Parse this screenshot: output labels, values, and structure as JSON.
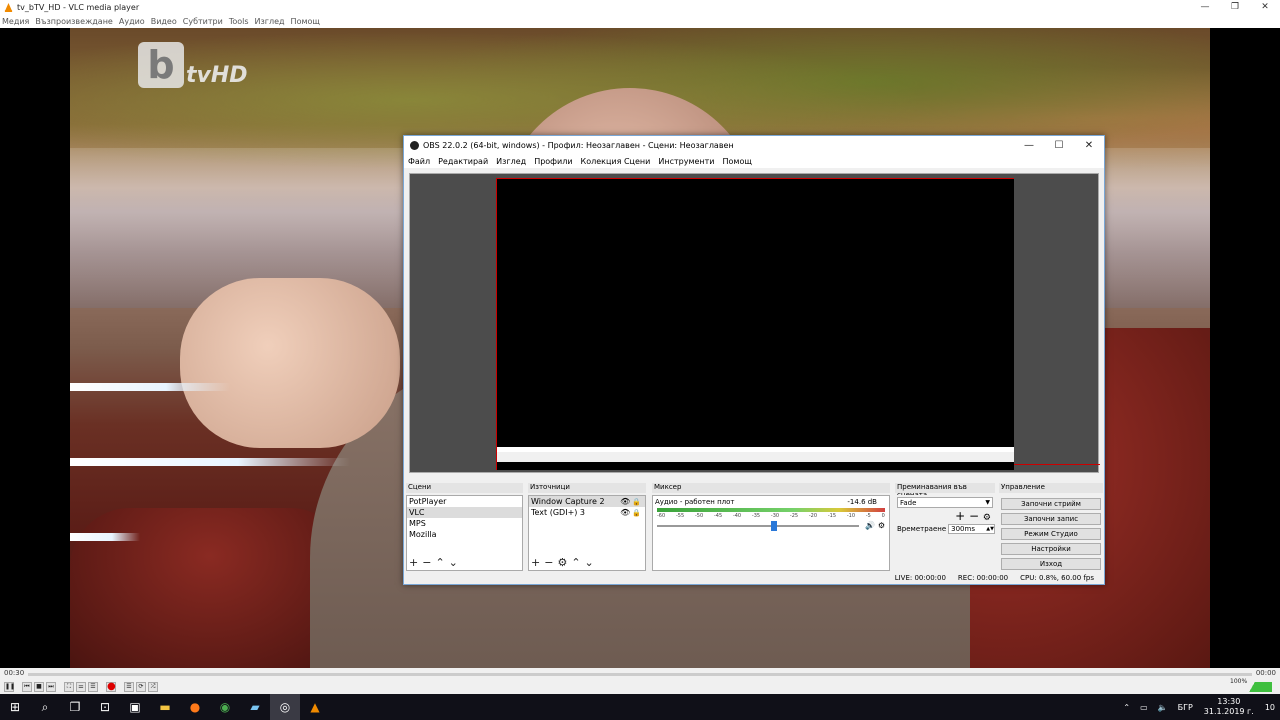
{
  "vlc": {
    "title": "tv_bTV_HD - VLC media player",
    "menu": [
      "Медия",
      "Възпроизвеждане",
      "Аудио",
      "Видео",
      "Субтитри",
      "Tools",
      "Изглед",
      "Помощ"
    ],
    "logo_b": "b",
    "logo_text": "tvHD",
    "time_elapsed": "00:30",
    "time_total": "00:00",
    "volume_percent": "100%"
  },
  "obs": {
    "title": "OBS 22.0.2 (64-bit, windows) - Профил: Неозаглавен - Сцени: Неозаглавен",
    "menu": [
      "Файл",
      "Редактирай",
      "Изглед",
      "Профили",
      "Колекция Сцени",
      "Инструменти",
      "Помощ"
    ],
    "docks": {
      "scenes": {
        "title": "Сцени",
        "items": [
          "PotPlayer",
          "VLC",
          "MPS",
          "Mozilla"
        ],
        "selected_index": 1
      },
      "sources": {
        "title": "Източници",
        "items": [
          "Window Capture 2",
          "Text (GDI+) 3"
        ],
        "selected_index": 0
      },
      "mixer": {
        "title": "Миксер",
        "channel": "Аудио - работен плот",
        "db": "-14.6 dB",
        "ticks": [
          "-60",
          "-55",
          "-50",
          "-45",
          "-40",
          "-35",
          "-30",
          "-25",
          "-20",
          "-15",
          "-10",
          "-5",
          "0"
        ]
      },
      "transitions": {
        "title": "Преминавания във сцената",
        "type": "Fade",
        "duration_label": "Времетраене",
        "duration_value": "300ms"
      },
      "controls": {
        "title": "Управление",
        "buttons": [
          "Започни стрийм",
          "Започни запис",
          "Режим Студио",
          "Настройки",
          "Изход"
        ]
      }
    },
    "status": {
      "live": "LIVE: 00:00:00",
      "rec": "REC: 00:00:00",
      "cpu": "CPU: 0.8%, 60.00 fps"
    }
  },
  "taskbar": {
    "lang": "БГР",
    "time": "13:30",
    "date": "31.1.2019 г.",
    "notifications": "10"
  }
}
